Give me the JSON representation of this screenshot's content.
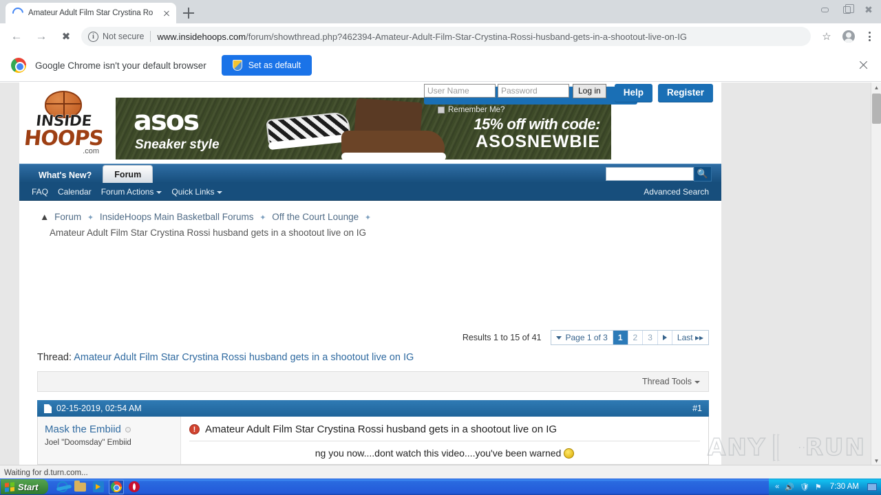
{
  "browser": {
    "tab": {
      "title": "Amateur Adult Film Star Crystina Ro",
      "spinner": "loading-spinner",
      "close": "close-icon"
    },
    "newtab_label": "+",
    "window": {
      "minimize": "minimize-icon",
      "maximize": "maximize-icon",
      "close": "close-icon"
    },
    "nav": {
      "back": "back-arrow-icon",
      "forward": "forward-arrow-icon",
      "stop": "stop-icon"
    },
    "omnibox": {
      "security_text": "Not secure",
      "info_glyph": "i",
      "url_domain": "www.insidehoops.com",
      "url_path": "/forum/showthread.php?462394-Amateur-Adult-Film-Star-Crystina-Rossi-husband-gets-in-a-shootout-live-on-IG",
      "star": "bookmark-star-icon",
      "profile": "profile-avatar-icon",
      "menu": "three-dot-menu-icon"
    },
    "infobar": {
      "message": "Google Chrome isn't your default browser",
      "button": "Set as default",
      "close": "close-icon"
    }
  },
  "site": {
    "logo": {
      "line1": "INSIDE",
      "line2": "HOOPS",
      "line3": ".com"
    },
    "banner": {
      "brand": "asos",
      "tagline": "Sneaker style",
      "promo_line1": "15% off with code:",
      "promo_line2": "ASOSNEWBIE"
    },
    "login": {
      "username_placeholder": "User Name",
      "password_placeholder": "Password",
      "login_button": "Log in",
      "remember_label": "Remember Me?",
      "help_button": "Help",
      "register_button": "Register"
    },
    "nav": {
      "tabs": [
        {
          "label": "What's New?",
          "active": false
        },
        {
          "label": "Forum",
          "active": true
        }
      ],
      "sublinks": [
        {
          "label": "FAQ",
          "has_caret": false
        },
        {
          "label": "Calendar",
          "has_caret": false
        },
        {
          "label": "Forum Actions",
          "has_caret": true
        },
        {
          "label": "Quick Links",
          "has_caret": true
        }
      ],
      "advanced_search": "Advanced Search",
      "search_value": "",
      "search_placeholder": ""
    },
    "breadcrumb": {
      "home_icon": "home-icon",
      "items": [
        "Forum",
        "InsideHoops Main Basketball Forums",
        "Off the Court Lounge"
      ],
      "current": "Amateur Adult Film Star Crystina Rossi husband gets in a shootout live on IG"
    },
    "pagination": {
      "results_text": "Results 1 to 15 of 41",
      "page_label": "Page 1 of 3",
      "pages": [
        "1",
        "2",
        "3"
      ],
      "current_page": "1",
      "next_label": "next-page-arrow",
      "last_label": "Last"
    },
    "thread": {
      "label": "Thread:",
      "title": "Amateur Adult Film Star Crystina Rossi husband gets in a shootout live on IG",
      "tools_label": "Thread Tools"
    },
    "post": {
      "date": "02-15-2019, 02:54 AM",
      "number": "#1",
      "author": "Mask the Embiid",
      "author_title": "Joel \"Doomsday\" Embiid",
      "title": "Amateur Adult Film Star Crystina Rossi husband gets in a shootout live on IG",
      "body": "ng you now....dont watch this video....you've been warned",
      "warn_glyph": "!"
    }
  },
  "watermark": {
    "left": "ANY",
    "right": "RUN"
  },
  "os": {
    "status_text": "Waiting for d.turn.com...",
    "start_label": "Start",
    "quicklaunch": [
      {
        "name": "internet-explorer-icon"
      },
      {
        "name": "folder-icon"
      },
      {
        "name": "media-player-icon"
      },
      {
        "name": "chrome-icon"
      },
      {
        "name": "opera-icon"
      }
    ],
    "tray": {
      "chevron": "«",
      "volume": "volume-icon",
      "shield": "security-icon",
      "flag": "flag-icon",
      "time": "7:30 AM",
      "desktop": "show-desktop-icon"
    }
  }
}
